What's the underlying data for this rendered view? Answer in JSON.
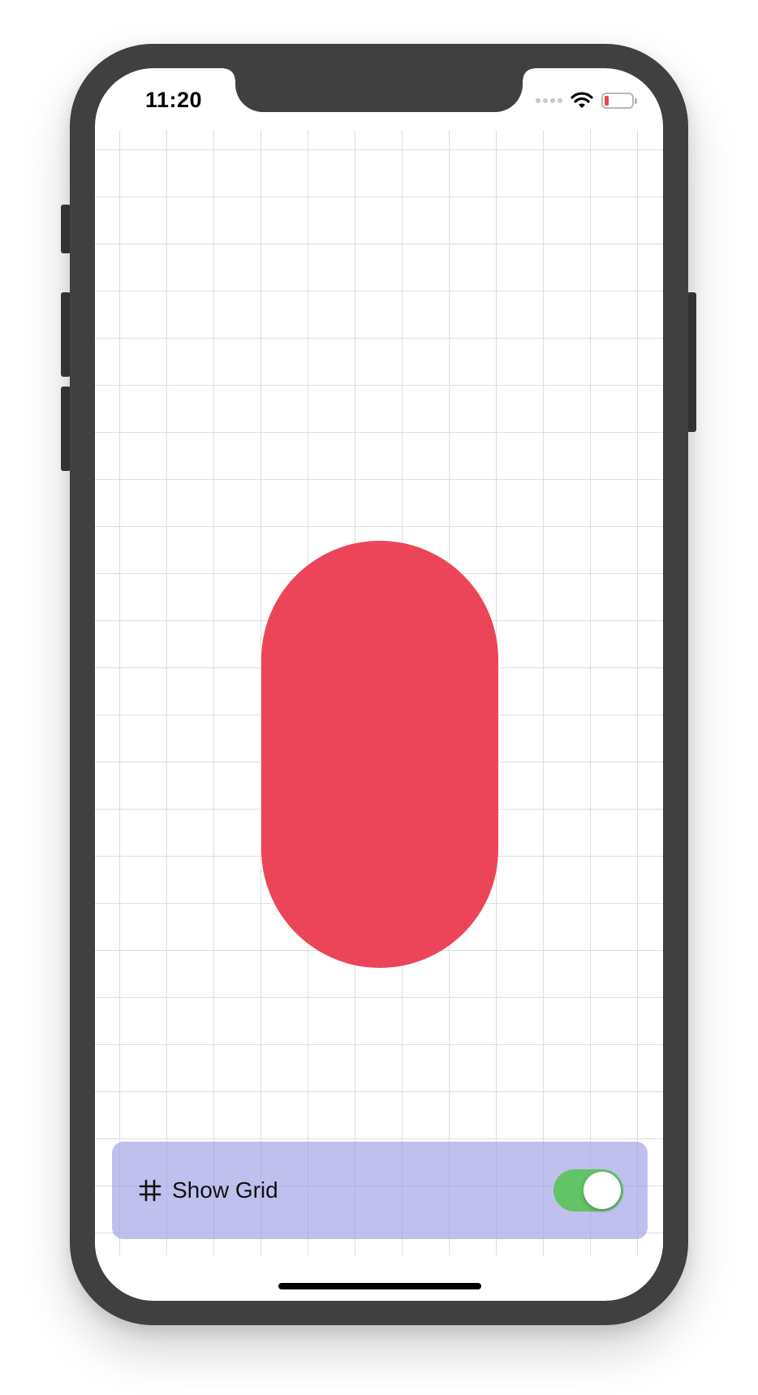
{
  "status_bar": {
    "time": "11:20",
    "battery_level": 0.15,
    "colors": {
      "battery_low": "#e8463f"
    }
  },
  "icons": {
    "wifi": "wifi-icon",
    "cellular": "cellular-signal-icon",
    "battery": "battery-icon",
    "grid": "hash-grid-icon"
  },
  "canvas": {
    "shape": "capsule",
    "shape_color": "#ec4559",
    "grid_visible": true
  },
  "controls": {
    "show_grid_label": "Show Grid",
    "show_grid_on": true,
    "panel_color": "#9e9ee6",
    "toggle_on_color": "#62c466"
  }
}
